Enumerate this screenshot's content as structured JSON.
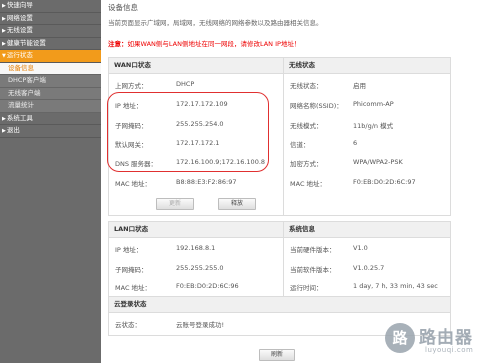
{
  "sidebar": {
    "items": [
      {
        "label": "快速向导"
      },
      {
        "label": "网络设置"
      },
      {
        "label": "无线设置"
      },
      {
        "label": "健康节能设置"
      },
      {
        "label": "运行状态"
      },
      {
        "label": "系统工具"
      },
      {
        "label": "退出"
      }
    ],
    "sub_items": [
      {
        "label": "设备信息"
      },
      {
        "label": "DHCP客户端"
      },
      {
        "label": "无线客户端"
      },
      {
        "label": "流量统计"
      }
    ]
  },
  "page": {
    "title": "设备信息",
    "description": "当前页面显示广域网，局域网，无线网络的网络参数以及路由器相关信息。",
    "notice_prefix": "注意：",
    "notice_text": "如果WAN侧与LAN侧地址在同一网段，请修改LAN IP地址！",
    "refresh_button": "刷新"
  },
  "wan": {
    "title": "WAN口状态",
    "rows": [
      {
        "label": "上网方式：",
        "value": "DHCP"
      },
      {
        "label": "IP 地址：",
        "value": "172.17.172.109"
      },
      {
        "label": "子网掩码：",
        "value": "255.255.254.0"
      },
      {
        "label": "默认网关：",
        "value": "172.17.172.1"
      },
      {
        "label": "DNS 服务器：",
        "value": "172.16.100.9;172.16.100.8"
      },
      {
        "label": "MAC 地址：",
        "value": "B8:88:E3:F2:86:97"
      }
    ],
    "button_release": "更新",
    "button_renew": "释放"
  },
  "wireless": {
    "title": "无线状态",
    "rows": [
      {
        "label": "无线状态：",
        "value": "启用"
      },
      {
        "label": "网络名称(SSID)：",
        "value": "Phicomm-AP"
      },
      {
        "label": "无线模式：",
        "value": "11b/g/n 模式"
      },
      {
        "label": "信道：",
        "value": "6"
      },
      {
        "label": "加密方式：",
        "value": "WPA/WPA2-PSK"
      },
      {
        "label": "MAC 地址：",
        "value": "F0:EB:D0:2D:6C:97"
      }
    ]
  },
  "lan": {
    "title": "LAN口状态",
    "rows": [
      {
        "label": "IP 地址：",
        "value": "192.168.8.1"
      },
      {
        "label": "子网掩码：",
        "value": "255.255.255.0"
      },
      {
        "label": "MAC 地址：",
        "value": "F0:EB:D0:2D:6C:96"
      }
    ]
  },
  "system": {
    "title": "系统信息",
    "rows": [
      {
        "label": "当前硬件版本：",
        "value": "V1.0"
      },
      {
        "label": "当前软件版本：",
        "value": "V1.0.25.7"
      },
      {
        "label": "运行时间：",
        "value": "1 day, 7 h, 33 min, 43 sec"
      }
    ]
  },
  "cloud": {
    "title": "云登录状态",
    "label": "云状态：",
    "value": "云账号登录成功!"
  },
  "watermark": {
    "logo_char": "路",
    "name_cn": "路由器",
    "name_en": "luyouqi.com"
  }
}
